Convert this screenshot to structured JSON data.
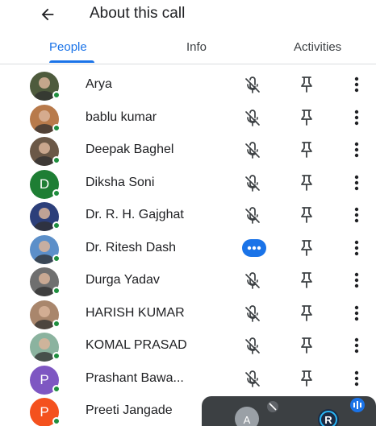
{
  "header": {
    "title": "About this call"
  },
  "tabs": [
    {
      "label": "People",
      "active": true
    },
    {
      "label": "Info",
      "active": false
    },
    {
      "label": "Activities",
      "active": false
    }
  ],
  "participants": [
    {
      "name": "Arya",
      "avatar": "photo",
      "status": "muted"
    },
    {
      "name": "bablu kumar",
      "avatar": "photo",
      "status": "muted"
    },
    {
      "name": "Deepak Baghel",
      "avatar": "photo",
      "status": "muted"
    },
    {
      "name": "Diksha Soni",
      "avatar": "D",
      "avatar_color": "#1e7e34",
      "status": "muted"
    },
    {
      "name": "Dr. R. H. Gajghat",
      "avatar": "photo",
      "status": "muted"
    },
    {
      "name": "Dr. Ritesh Dash",
      "avatar": "photo",
      "status": "speaking"
    },
    {
      "name": "Durga Yadav",
      "avatar": "photo",
      "status": "muted"
    },
    {
      "name": "HARISH KUMAR",
      "avatar": "photo",
      "status": "muted"
    },
    {
      "name": "KOMAL PRASAD",
      "avatar": "photo",
      "status": "muted"
    },
    {
      "name": "Prashant Bawa...",
      "avatar": "P",
      "avatar_color": "#7e57c2",
      "status": "muted"
    },
    {
      "name": "Preeti Jangade",
      "avatar": "P",
      "avatar_color": "#f4511e",
      "status": "muted"
    }
  ],
  "pip": {
    "tile_initial": "A",
    "tile_brand": "R"
  },
  "colors": {
    "accent": "#1a73e8",
    "online": "#1e8e3e",
    "text": "#202124"
  }
}
